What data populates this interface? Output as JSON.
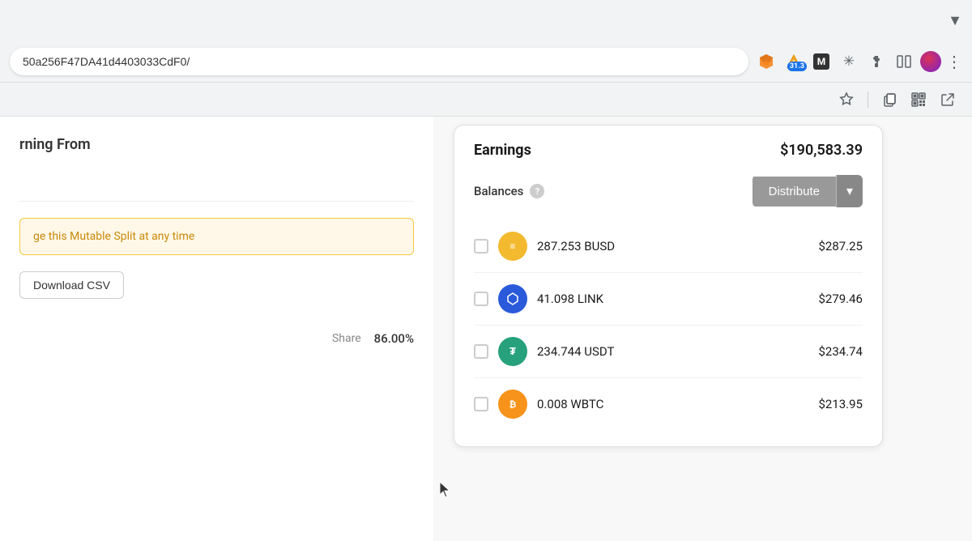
{
  "browser": {
    "address": "50a256F47DA41d4403033CdF0/",
    "chevron_label": "▼",
    "three_dots_label": "⋮",
    "badge_label": "31.3"
  },
  "bookmarks": {
    "star_label": "★",
    "copy_label": "⧉",
    "qr_label": "▦",
    "external_label": "↗"
  },
  "left_panel": {
    "title": "rning From",
    "mutable_notice": "ge this Mutable Split at any time",
    "download_csv_label": "Download CSV",
    "share_label": "Share",
    "share_value": "86.00%"
  },
  "right_panel": {
    "earnings_title": "Earnings",
    "earnings_total": "$190,583.39",
    "balances_label": "Balances",
    "distribute_label": "Distribute",
    "distribute_chevron": "▾",
    "help_icon": "?",
    "tokens": [
      {
        "amount": "287.253 BUSD",
        "value": "$287.25",
        "icon_type": "busd",
        "icon_label": "≡"
      },
      {
        "amount": "41.098 LINK",
        "value": "$279.46",
        "icon_type": "link",
        "icon_label": "⬡"
      },
      {
        "amount": "234.744 USDT",
        "value": "$234.74",
        "icon_type": "usdt",
        "icon_label": "₮"
      },
      {
        "amount": "0.008 WBTC",
        "value": "$213.95",
        "icon_type": "wbtc",
        "icon_label": "₿"
      }
    ]
  }
}
